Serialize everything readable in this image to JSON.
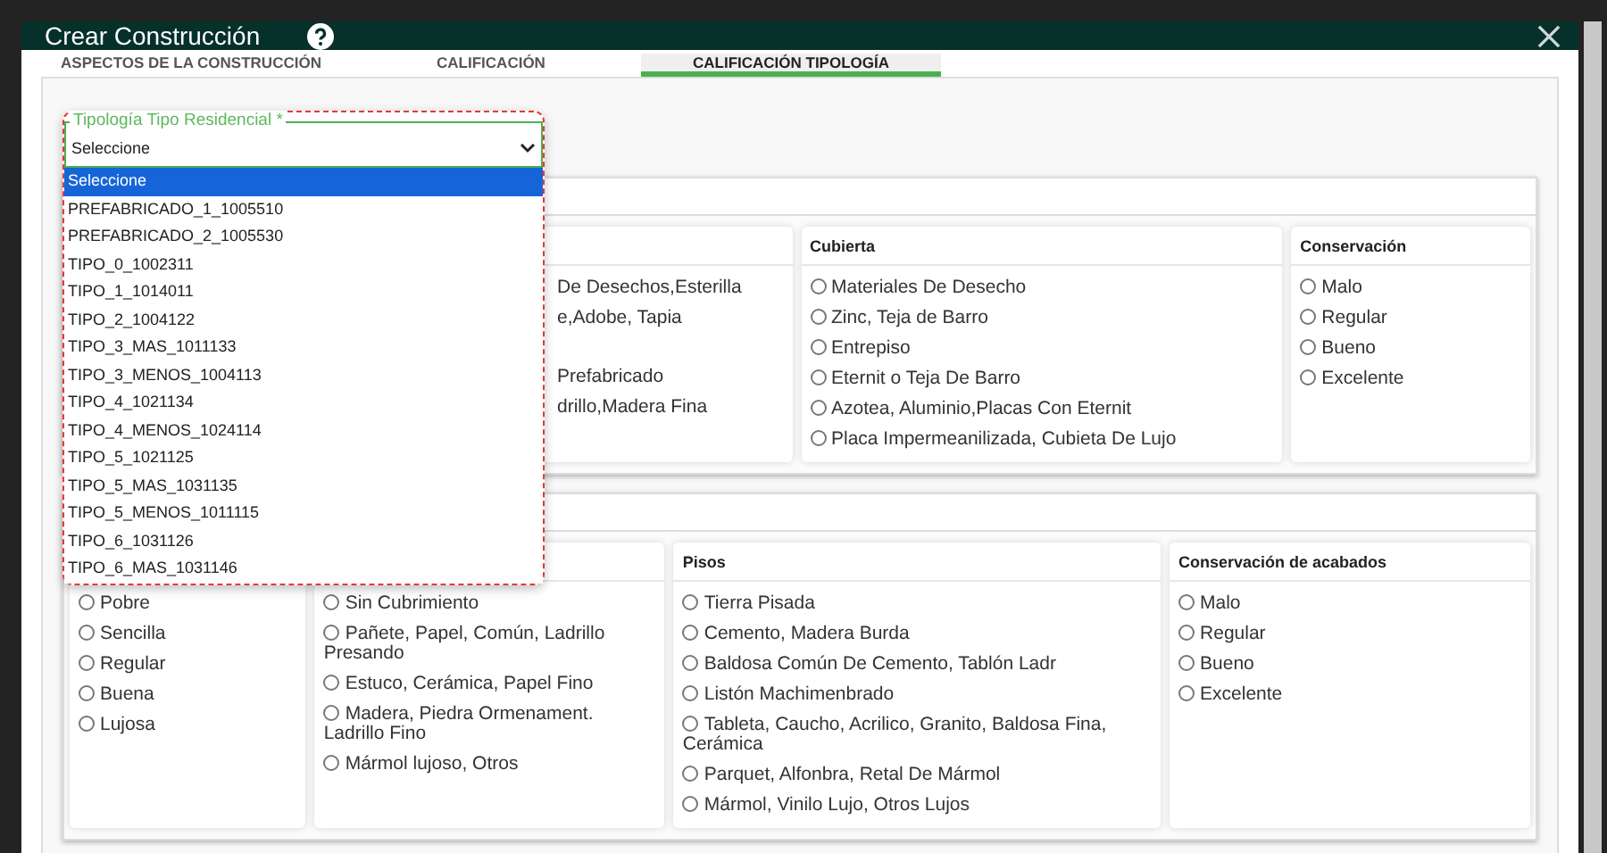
{
  "window": {
    "title": "Crear Construcción"
  },
  "tabs": [
    {
      "label": "ASPECTOS DE LA CONSTRUCCIÓN",
      "selected": false
    },
    {
      "label": "CALIFICACIÓN",
      "selected": false
    },
    {
      "label": "CALIFICACIÓN TIPOLOGÍA",
      "selected": true
    }
  ],
  "typology_field": {
    "label": "Tipología Tipo Residencial *",
    "value": "Seleccione",
    "expanded": true,
    "options": [
      {
        "label": "Seleccione",
        "selected": true
      },
      {
        "label": "PREFABRICADO_1_1005510",
        "selected": false
      },
      {
        "label": "PREFABRICADO_2_1005530",
        "selected": false
      },
      {
        "label": "TIPO_0_1002311",
        "selected": false
      },
      {
        "label": "TIPO_1_1014011",
        "selected": false
      },
      {
        "label": "TIPO_2_1004122",
        "selected": false
      },
      {
        "label": "TIPO_3_MAS_1011133",
        "selected": false
      },
      {
        "label": "TIPO_3_MENOS_1004113",
        "selected": false
      },
      {
        "label": "TIPO_4_1021134",
        "selected": false
      },
      {
        "label": "TIPO_4_MENOS_1024114",
        "selected": false
      },
      {
        "label": "TIPO_5_1021125",
        "selected": false
      },
      {
        "label": "TIPO_5_MAS_1031135",
        "selected": false
      },
      {
        "label": "TIPO_5_MENOS_1011115",
        "selected": false
      },
      {
        "label": "TIPO_6_1031126",
        "selected": false
      },
      {
        "label": "TIPO_6_MAS_1031146",
        "selected": false
      }
    ]
  },
  "sections": [
    {
      "cards": [
        {
          "kind": "covered",
          "options": [
            {
              "label": "De Desechos,Esterilla"
            },
            {
              "label": "e,Adobe, Tapia"
            },
            {
              "label": "Prefabricado"
            },
            {
              "label": "drillo,Madera Fina"
            }
          ]
        },
        {
          "kind": "radios",
          "title": "Cubierta",
          "options": [
            {
              "label": "Materiales De Desecho",
              "selected": false
            },
            {
              "label": "Zinc, Teja de Barro",
              "selected": false
            },
            {
              "label": "Entrepiso",
              "selected": false
            },
            {
              "label": "Eternit o Teja De Barro",
              "selected": false
            },
            {
              "label": "Azotea, Aluminio,Placas Con Eternit",
              "selected": false
            },
            {
              "label": "Placa Impermeanilizada, Cubieta De Lujo",
              "selected": false
            }
          ]
        },
        {
          "kind": "radios",
          "title": "Conservación",
          "options": [
            {
              "label": "Malo",
              "selected": false
            },
            {
              "label": "Regular",
              "selected": false
            },
            {
              "label": "Bueno",
              "selected": false
            },
            {
              "label": "Excelente",
              "selected": false
            }
          ]
        }
      ]
    },
    {
      "cards": [
        {
          "kind": "radios",
          "options": [
            {
              "label": "Pobre",
              "selected": false
            },
            {
              "label": "Sencilla",
              "selected": false
            },
            {
              "label": "Regular",
              "selected": false
            },
            {
              "label": "Buena",
              "selected": false
            },
            {
              "label": "Lujosa",
              "selected": false
            }
          ]
        },
        {
          "kind": "radios",
          "options": [
            {
              "label": "Sin Cubrimiento",
              "selected": false
            },
            {
              "label": "Pañete, Papel, Común, Ladrillo Presando",
              "selected": false
            },
            {
              "label": "Estuco, Cerámica, Papel Fino",
              "selected": false
            },
            {
              "label": "Madera, Piedra Ormenament. Ladrillo Fino",
              "selected": false
            },
            {
              "label": "Mármol lujoso, Otros",
              "selected": false
            }
          ]
        },
        {
          "kind": "radios",
          "title": "Pisos",
          "options": [
            {
              "label": "Tierra Pisada",
              "selected": false
            },
            {
              "label": "Cemento, Madera Burda",
              "selected": false
            },
            {
              "label": "Baldosa Común De Cemento, Tablón Ladr",
              "selected": false
            },
            {
              "label": "Listón Machimenbrado",
              "selected": false
            },
            {
              "label": "Tableta, Caucho, Acrilico, Granito, Baldosa Fina, Cerámica",
              "selected": false
            },
            {
              "label": "Parquet, Alfonbra, Retal De Mármol",
              "selected": false
            },
            {
              "label": "Mármol, Vinilo Lujo, Otros Lujos",
              "selected": false
            }
          ]
        },
        {
          "kind": "radios",
          "title": "Conservación de acabados",
          "options": [
            {
              "label": "Malo",
              "selected": false
            },
            {
              "label": "Regular",
              "selected": false
            },
            {
              "label": "Bueno",
              "selected": false
            },
            {
              "label": "Excelente",
              "selected": false
            }
          ]
        }
      ]
    }
  ]
}
